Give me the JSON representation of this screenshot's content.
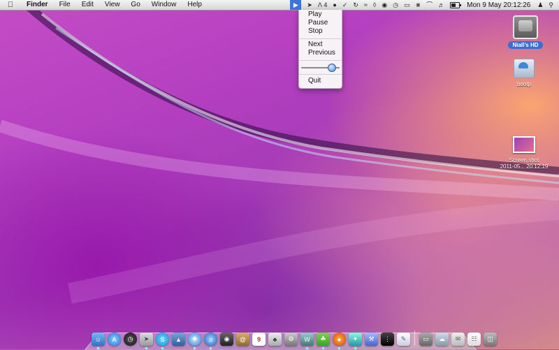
{
  "menubar": {
    "app_name": "Finder",
    "menus": [
      "File",
      "Edit",
      "View",
      "Go",
      "Window",
      "Help"
    ],
    "status_count": "4",
    "clock": "Mon 9 May  20:12:26",
    "battery_level": 0.6
  },
  "player_menu": {
    "items": [
      "Play",
      "Pause",
      "Stop",
      "Next",
      "Previous",
      "Quit"
    ],
    "volume_level": 0.85
  },
  "desktop": {
    "hd_label": "Niall’s HD",
    "bootp_label": "bootp",
    "screenshot_label_line1": "Screen shot",
    "screenshot_label_line2": "2011-05... 20.12.19"
  },
  "dock": {
    "calendar_day": "9",
    "icons": [
      "finder-icon",
      "app-store-icon",
      "dashboard-icon",
      "mail-icon",
      "skype-icon",
      "preview-icon",
      "safari-icon",
      "itunes-icon",
      "photo-booth-icon",
      "address-book-icon",
      "ical-icon",
      "iphoto-icon",
      "system-preferences-icon",
      "pages-icon",
      "growl-icon",
      "firefox-icon",
      "twitter-icon",
      "xcode-icon",
      "blackberry-icon",
      "textedit-icon",
      "drive-icon",
      "cloud-icon",
      "mail-stack-icon",
      "documents-stack-icon",
      "trash-icon"
    ]
  }
}
